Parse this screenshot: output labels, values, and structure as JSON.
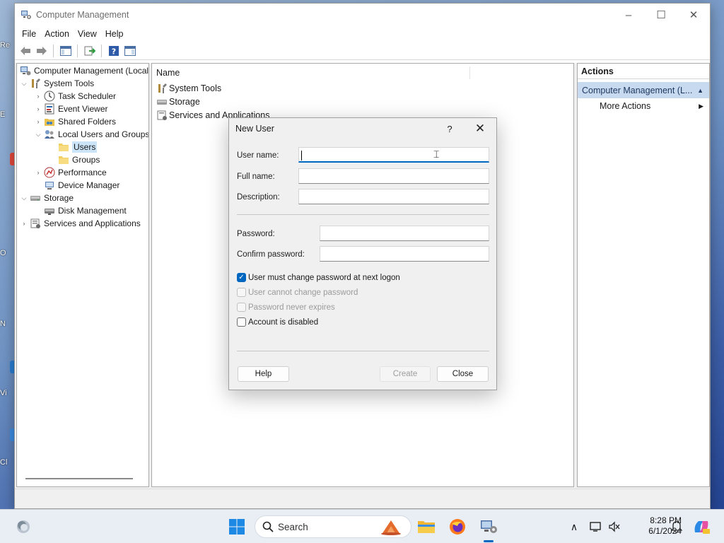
{
  "desktop": {
    "peek_labels": [
      "Re",
      "E",
      "O",
      "N",
      "Vi",
      "Cl"
    ]
  },
  "window": {
    "title": "Computer Management",
    "icon": "computer-management-icon",
    "controls": [
      "minimize-icon",
      "maximize-icon",
      "close-icon"
    ]
  },
  "menu": [
    "File",
    "Action",
    "View",
    "Help"
  ],
  "toolbar": {
    "buttons": [
      "back-arrow-icon",
      "forward-arrow-icon",
      "show-hide-tree-icon",
      "export-list-icon",
      "help-icon",
      "show-hide-action-pane-icon"
    ]
  },
  "tree": {
    "root": "Computer Management (Local",
    "system_tools": "System Tools",
    "task_scheduler": "Task Scheduler",
    "event_viewer": "Event Viewer",
    "shared_folders": "Shared Folders",
    "local_users_groups": "Local Users and Groups",
    "users": "Users",
    "groups": "Groups",
    "performance": "Performance",
    "device_manager": "Device Manager",
    "storage": "Storage",
    "disk_management": "Disk Management",
    "services_apps": "Services and Applications"
  },
  "center": {
    "column_header": "Name",
    "rows": [
      "System Tools",
      "Storage",
      "Services and Applications"
    ]
  },
  "actions": {
    "header": "Actions",
    "section": "Computer Management (L...",
    "more_actions": "More Actions"
  },
  "dialog": {
    "title": "New User",
    "help_glyph": "?",
    "fields": {
      "user_name": {
        "label": "User name:",
        "value": ""
      },
      "full_name": {
        "label": "Full name:",
        "value": ""
      },
      "description": {
        "label": "Description:",
        "value": ""
      },
      "password": {
        "label": "Password:",
        "value": ""
      },
      "confirm_password": {
        "label": "Confirm password:",
        "value": ""
      }
    },
    "checkboxes": {
      "must_change": {
        "label": "User must change password at next logon",
        "checked": true,
        "enabled": true
      },
      "cannot_change": {
        "label": "User cannot change password",
        "checked": false,
        "enabled": false
      },
      "never_expires": {
        "label": "Password never expires",
        "checked": false,
        "enabled": false
      },
      "disabled": {
        "label": "Account is disabled",
        "checked": false,
        "enabled": true
      }
    },
    "buttons": {
      "help": "Help",
      "create": "Create",
      "close": "Close"
    }
  },
  "taskbar": {
    "search_label": "Search",
    "time": "8:28 PM",
    "date": "6/1/2024",
    "pinned": [
      "windows-start-icon",
      "file-explorer-icon",
      "firefox-icon",
      "computer-management-taskbar-icon"
    ],
    "accent": "#0067c0"
  }
}
